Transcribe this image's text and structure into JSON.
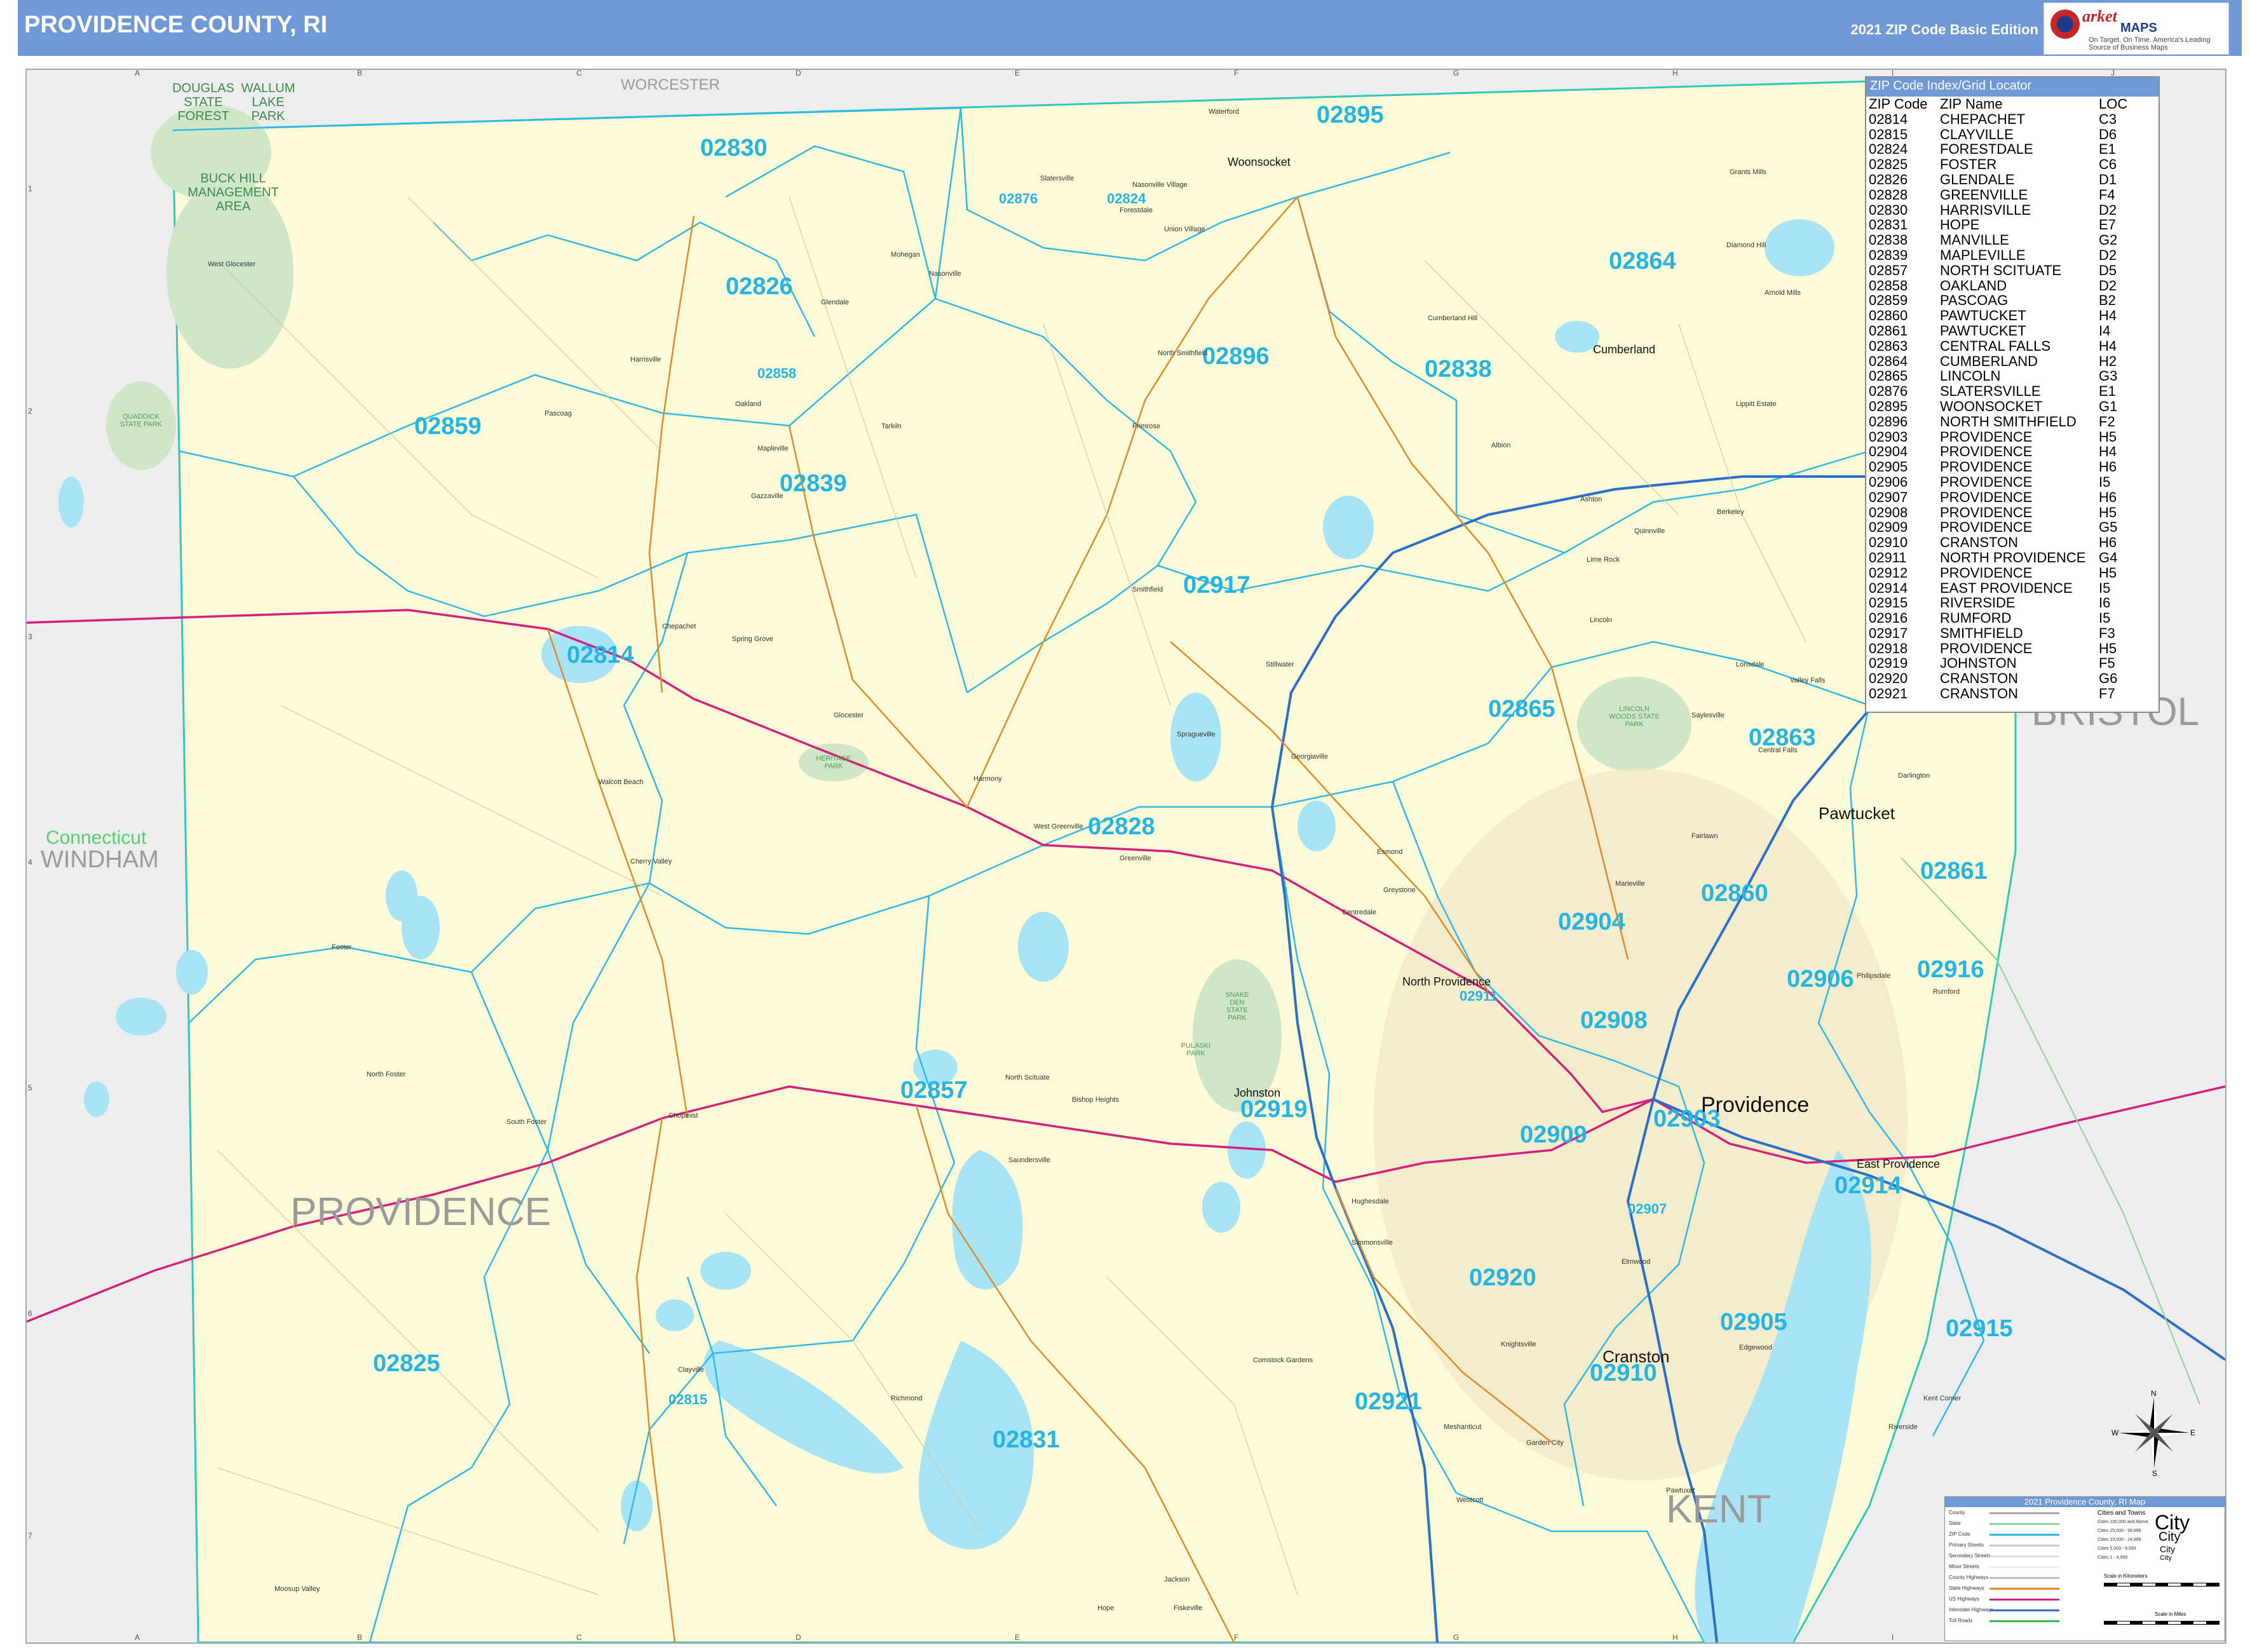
{
  "header": {
    "title": "PROVIDENCE COUNTY, RI",
    "edition": "2021 ZIP Code Basic Edition",
    "logo_brand": "arket",
    "logo_brand2": "MAPS",
    "logo_slogan": "On Target. On Time. America's Leading Source of Business Maps"
  },
  "grid": {
    "letters": [
      "A",
      "B",
      "C",
      "D",
      "E",
      "F",
      "G",
      "H",
      "I",
      "J"
    ],
    "numbers": [
      "1",
      "2",
      "3",
      "4",
      "5",
      "6",
      "7"
    ]
  },
  "regions": {
    "worcester": "WORCESTER",
    "connecticut": "Connecticut",
    "windham": "WINDHAM",
    "providence": "PROVIDENCE",
    "bristol": "BRISTOL",
    "kent": "KENT",
    "n": "N"
  },
  "parks": {
    "douglas": "DOUGLAS STATE FOREST",
    "wallum": "WALLUM LAKE PARK",
    "buckhill": "BUCK HILL MANAGEMENT AREA",
    "lincoln": "LINCOLN WOODS STATE PARK",
    "snakeden": "SNAKE DEN STATE PARK",
    "heritage": "HERITAGE PARK",
    "quaddick": "QUADDICK STATE PARK",
    "pulaski": "PULASKI PARK"
  },
  "zips": [
    {
      "code": "02895"
    },
    {
      "code": "02830"
    },
    {
      "code": "02876"
    },
    {
      "code": "02824"
    },
    {
      "code": "02864"
    },
    {
      "code": "02826"
    },
    {
      "code": "02858"
    },
    {
      "code": "02896"
    },
    {
      "code": "02838"
    },
    {
      "code": "02859"
    },
    {
      "code": "02839"
    },
    {
      "code": "02917"
    },
    {
      "code": "02814"
    },
    {
      "code": "02865"
    },
    {
      "code": "02863"
    },
    {
      "code": "02828"
    },
    {
      "code": "02861"
    },
    {
      "code": "02860"
    },
    {
      "code": "02904"
    },
    {
      "code": "02911"
    },
    {
      "code": "02906"
    },
    {
      "code": "02916"
    },
    {
      "code": "02908"
    },
    {
      "code": "02857"
    },
    {
      "code": "02919"
    },
    {
      "code": "02909"
    },
    {
      "code": "02903"
    },
    {
      "code": "02914"
    },
    {
      "code": "02907"
    },
    {
      "code": "02920"
    },
    {
      "code": "02905"
    },
    {
      "code": "02915"
    },
    {
      "code": "02825"
    },
    {
      "code": "02910"
    },
    {
      "code": "02921"
    },
    {
      "code": "02815"
    },
    {
      "code": "02831"
    }
  ],
  "cities": {
    "woonsocket": "Woonsocket",
    "cumberland": "Cumberland",
    "pawtucket": "Pawtucket",
    "northprovidence": "North Providence",
    "johnston": "Johnston",
    "providence": "Providence",
    "eastprovidence": "East Providence",
    "cranston": "Cranston"
  },
  "places": {
    "waterford": "Waterford",
    "grantsmills": "Grants Mills",
    "slatersville": "Slatersville",
    "nassonville": "Nasonville Village",
    "forestdale": "Forestdale",
    "unionvillage": "Union Village",
    "westglocester": "West Glocester",
    "mohegan": "Mohegan",
    "nasonville": "Nasonville",
    "glendale": "Glendale",
    "diamondhill": "Diamond Hill",
    "cumberlandhill": "Cumberland Hill",
    "arnoldmills": "Arnold Mills",
    "harrisville": "Harrisville",
    "northsmithfield": "North Smithfield",
    "pascoag": "Pascoag",
    "oakland": "Oakland",
    "tarkiln": "Tarkiln",
    "primrose": "Primrose",
    "lippittestate": "Lippitt Estate",
    "albion": "Albion",
    "mapleville": "Mapleville",
    "gazzaville": "Gazzaville",
    "ashton": "Ashton",
    "quinnville": "Quinnville",
    "limerock": "Lime Rock",
    "berkeley": "Berkeley",
    "smithfield": "Smithfield",
    "chepachet": "Chepachet",
    "springgrove": "Spring Grove",
    "lincoln": "Lincoln",
    "stillwater": "Stillwater",
    "lonsdale": "Lonsdale",
    "valleyfalls": "Valley Falls",
    "glocester": "Glocester",
    "saylesville": "Saylesville",
    "spragueville": "Spragueville",
    "georgiaville": "Georgiaville",
    "centralfalls": "Central Falls",
    "darlington": "Darlington",
    "harmony": "Harmony",
    "wallumtuck": "Walcott Beach",
    "westgreenville": "West Greenville",
    "greenville": "Greenville",
    "esmond": "Esmond",
    "fairlawn": "Fairlawn",
    "cherryvalley": "Cherry Valley",
    "greystone": "Greystone",
    "marieville": "Marieville",
    "centredale": "Centredale",
    "foster": "Foster",
    "philipsdale": "Philipsdale",
    "rumford": "Rumford",
    "northfoster": "North Foster",
    "northscituate": "North Scituate",
    "bishopheights": "Bishop Heights",
    "southfoster": "South Foster",
    "chopmist": "Chopmist",
    "saundersville": "Saundersville",
    "hughesdale": "Hughesdale",
    "simmonsville": "Simmonsville",
    "elmwood": "Elmwood",
    "clayville": "Clayville",
    "richmond": "Richmond",
    "knightsville": "Knightsville",
    "edgewood": "Edgewood",
    "comstockgardens": "Comstock Gardens",
    "keltcove": "Kent Corner",
    "riverside": "Riverside",
    "meshanticut": "Meshanticut",
    "garden": "Garden City",
    "pawtuxet": "Pawtuxet",
    "moosupvalley": "Moosup Valley",
    "jackson": "Jackson",
    "hope": "Hope",
    "fiskeville": "Fiskeville",
    "westwarwick": "Westcott"
  },
  "zip_index": {
    "title": "ZIP Code Index/Grid Locator",
    "headers": [
      "ZIP Code",
      "ZIP Name",
      "LOC"
    ],
    "rows": [
      [
        "02814",
        "CHEPACHET",
        "C3"
      ],
      [
        "02815",
        "CLAYVILLE",
        "D6"
      ],
      [
        "02824",
        "FORESTDALE",
        "E1"
      ],
      [
        "02825",
        "FOSTER",
        "C6"
      ],
      [
        "02826",
        "GLENDALE",
        "D1"
      ],
      [
        "02828",
        "GREENVILLE",
        "F4"
      ],
      [
        "02830",
        "HARRISVILLE",
        "D2"
      ],
      [
        "02831",
        "HOPE",
        "E7"
      ],
      [
        "02838",
        "MANVILLE",
        "G2"
      ],
      [
        "02839",
        "MAPLEVILLE",
        "D2"
      ],
      [
        "02857",
        "NORTH SCITUATE",
        "D5"
      ],
      [
        "02858",
        "OAKLAND",
        "D2"
      ],
      [
        "02859",
        "PASCOAG",
        "B2"
      ],
      [
        "02860",
        "PAWTUCKET",
        "H4"
      ],
      [
        "02861",
        "PAWTUCKET",
        "I4"
      ],
      [
        "02863",
        "CENTRAL FALLS",
        "H4"
      ],
      [
        "02864",
        "CUMBERLAND",
        "H2"
      ],
      [
        "02865",
        "LINCOLN",
        "G3"
      ],
      [
        "02876",
        "SLATERSVILLE",
        "E1"
      ],
      [
        "02895",
        "WOONSOCKET",
        "G1"
      ],
      [
        "02896",
        "NORTH SMITHFIELD",
        "F2"
      ],
      [
        "02903",
        "PROVIDENCE",
        "H5"
      ],
      [
        "02904",
        "PROVIDENCE",
        "H4"
      ],
      [
        "02905",
        "PROVIDENCE",
        "H6"
      ],
      [
        "02906",
        "PROVIDENCE",
        "I5"
      ],
      [
        "02907",
        "PROVIDENCE",
        "H6"
      ],
      [
        "02908",
        "PROVIDENCE",
        "H5"
      ],
      [
        "02909",
        "PROVIDENCE",
        "G5"
      ],
      [
        "02910",
        "CRANSTON",
        "H6"
      ],
      [
        "02911",
        "NORTH PROVIDENCE",
        "G4"
      ],
      [
        "02912",
        "PROVIDENCE",
        "H5"
      ],
      [
        "02914",
        "EAST PROVIDENCE",
        "I5"
      ],
      [
        "02915",
        "RIVERSIDE",
        "I6"
      ],
      [
        "02916",
        "RUMFORD",
        "I5"
      ],
      [
        "02917",
        "SMITHFIELD",
        "F3"
      ],
      [
        "02918",
        "PROVIDENCE",
        "H5"
      ],
      [
        "02919",
        "JOHNSTON",
        "F5"
      ],
      [
        "02920",
        "CRANSTON",
        "G6"
      ],
      [
        "02921",
        "CRANSTON",
        "F7"
      ]
    ]
  },
  "legend": {
    "title": "2021 Providence County, RI Map",
    "items": [
      "County",
      "State",
      "ZIP Code",
      "Primary Streets",
      "Secondary Streets",
      "Minor Streets",
      "County Highways",
      "State Highways",
      "US Highways",
      "Interstate Highways",
      "Toll Roads"
    ],
    "cities_title": "Cities and Towns",
    "city_sizes": [
      "Cities 100,000 and Above",
      "Cities 25,000 - 99,999",
      "Cities 10,000 - 24,999",
      "Cities 5,000 - 9,999",
      "Cities 1 - 4,999"
    ],
    "city_samples": [
      "City",
      "City",
      "City",
      "City"
    ],
    "scale_km": "Scale in Kilometers",
    "scale_mi": "Scale in Miles"
  },
  "compass": {
    "n": "N",
    "e": "E",
    "w": "W",
    "s": "S"
  },
  "colors": {
    "header": "#6f98d6",
    "land": "#fdfbd7",
    "water": "#a8e4f5",
    "zip_boundary": "#2fb8e8",
    "zip_label": "#24b4e6",
    "interstate": "#2a6fc9",
    "us_highway": "#d4217e",
    "state_highway": "#e08a2b",
    "park": "#cfe6c9"
  }
}
